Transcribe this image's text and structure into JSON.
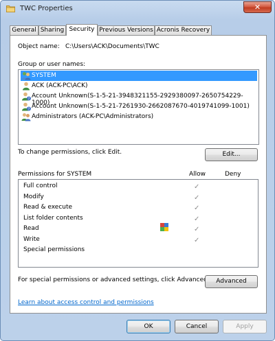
{
  "window": {
    "title": "TWC Properties",
    "close_symbol": "✕"
  },
  "tabs": [
    {
      "label": "General",
      "active": false
    },
    {
      "label": "Sharing",
      "active": false
    },
    {
      "label": "Security",
      "active": true
    },
    {
      "label": "Previous Versions",
      "active": false
    },
    {
      "label": "Acronis Recovery",
      "active": false
    }
  ],
  "object": {
    "label": "Object name:",
    "value": "C:\\Users\\ACK\\Documents\\TWC"
  },
  "users": {
    "label": "Group or user names:",
    "items": [
      {
        "name": "SYSTEM",
        "icon": "users-group-icon",
        "selected": true
      },
      {
        "name": "ACK (ACK-PC\\ACK)",
        "icon": "user-icon",
        "selected": false
      },
      {
        "name": "Account Unknown(S-1-5-21-3948321155-2929380097-2650754229-1000)",
        "icon": "unknown-user-icon",
        "selected": false
      },
      {
        "name": "Account Unknown(S-1-5-21-7261930-2662087670-4019741099-1001)",
        "icon": "unknown-user-icon",
        "selected": false
      },
      {
        "name": "Administrators (ACK-PC\\Administrators)",
        "icon": "users-group-icon",
        "selected": false
      }
    ]
  },
  "change_text": "To change permissions, click Edit.",
  "edit_button": "Edit...",
  "permissions": {
    "label": "Permissions for SYSTEM",
    "allow_header": "Allow",
    "deny_header": "Deny",
    "check_symbol": "✓",
    "items": [
      {
        "name": "Full control",
        "allow": true,
        "deny": false
      },
      {
        "name": "Modify",
        "allow": true,
        "deny": false
      },
      {
        "name": "Read & execute",
        "allow": true,
        "deny": false
      },
      {
        "name": "List folder contents",
        "allow": true,
        "deny": false
      },
      {
        "name": "Read",
        "allow": true,
        "deny": false
      },
      {
        "name": "Write",
        "allow": true,
        "deny": false
      },
      {
        "name": "Special permissions",
        "allow": false,
        "deny": false
      }
    ]
  },
  "special_text": "For special permissions or advanced settings, click Advanced.",
  "advanced_button": "Advanced",
  "learn_link": "Learn about access control and permissions",
  "footer": {
    "ok": "OK",
    "cancel": "Cancel",
    "apply": "Apply"
  },
  "colors": {
    "selection": "#3399ff",
    "link": "#0066cc",
    "close": "#c13d22"
  }
}
